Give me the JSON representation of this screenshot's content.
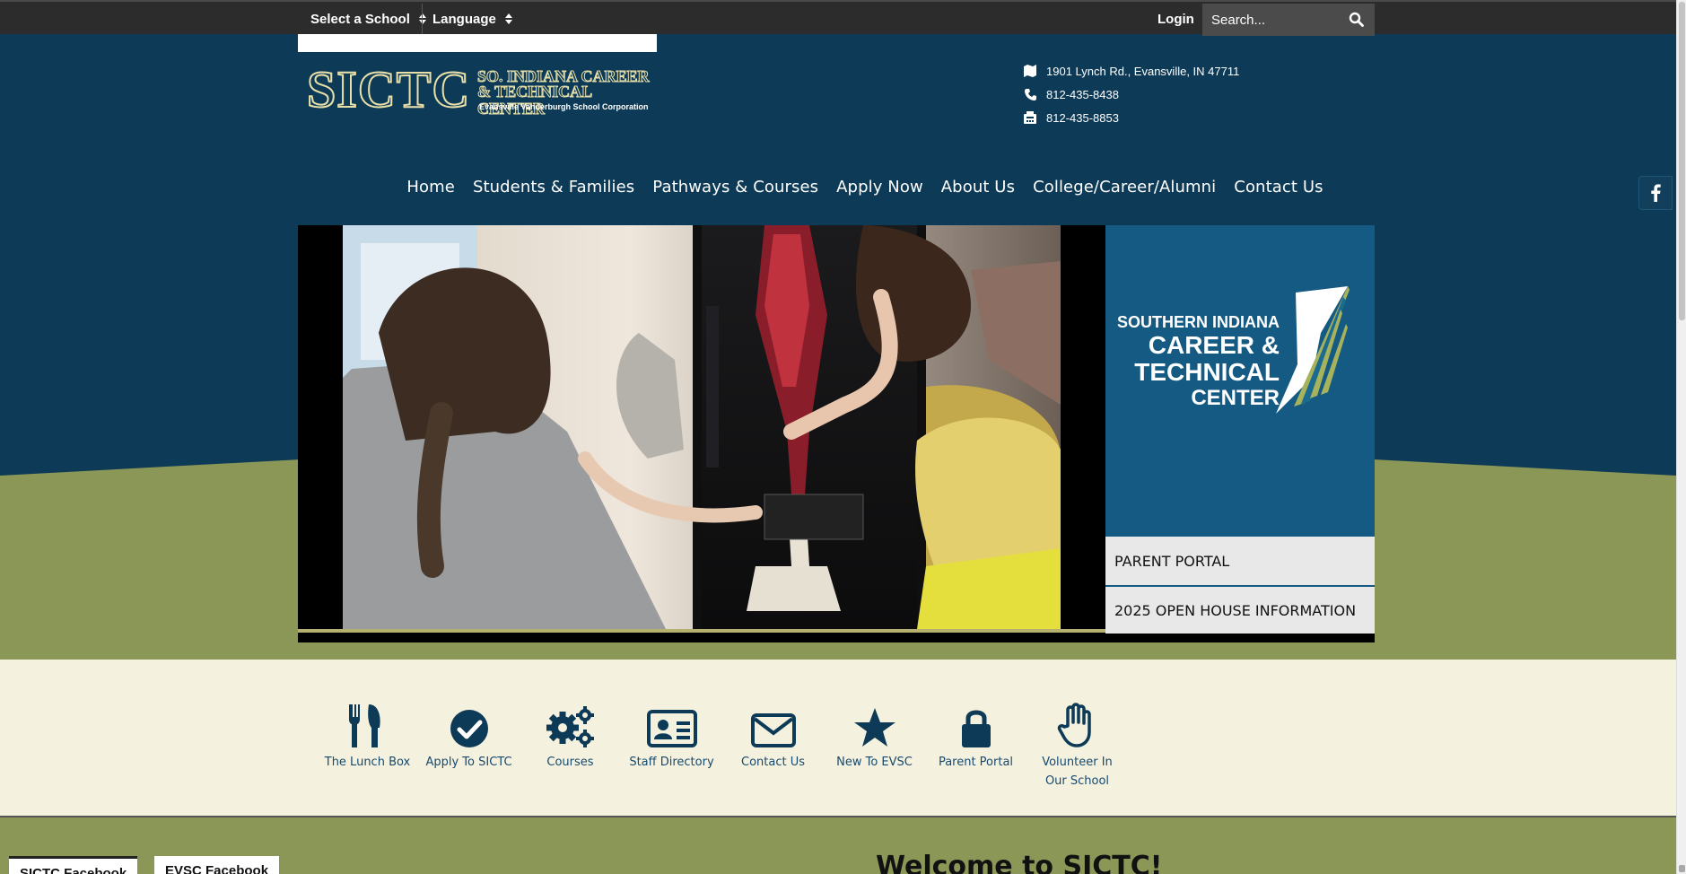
{
  "topbar": {
    "school_select": "Select a School",
    "language_select": "Language",
    "login": "Login",
    "search_placeholder": "Search..."
  },
  "header": {
    "logo_abbrev": "SICTC",
    "logo_name_line1": "SO. INDIANA CAREER",
    "logo_name_line2": "& TECHNICAL CENTER",
    "logo_subtitle": "Evansville Vanderburgh School Corporation",
    "address": "1901 Lynch Rd., Evansville, IN 47711",
    "phone": "812-435-8438",
    "fax": "812-435-8853"
  },
  "nav": {
    "items": [
      "Home",
      "Students & Families",
      "Pathways & Courses",
      "Apply Now",
      "About Us",
      "College/Career/Alumni",
      "Contact Us"
    ]
  },
  "promo": {
    "line1": "SOUTHERN INDIANA",
    "line2": "CAREER &",
    "line3": "TECHNICAL",
    "line4": "CENTER",
    "links": [
      "PARENT PORTAL",
      "2025 OPEN HOUSE INFORMATION"
    ]
  },
  "quick_links": [
    {
      "label": "The Lunch Box",
      "icon": "utensils-icon"
    },
    {
      "label": "Apply To SICTC",
      "icon": "check-circle-icon"
    },
    {
      "label": "Courses",
      "icon": "gears-icon"
    },
    {
      "label": "Staff Directory",
      "icon": "id-card-icon"
    },
    {
      "label": "Contact Us",
      "icon": "envelope-icon"
    },
    {
      "label": "New To EVSC",
      "icon": "star-icon"
    },
    {
      "label": "Parent Portal",
      "icon": "lock-icon"
    },
    {
      "label": "Volunteer In Our School",
      "icon": "hand-icon"
    }
  ],
  "bottom": {
    "tab1": "SICTC Facebook",
    "tab2": "EVSC Facebook",
    "welcome": "Welcome to SICTC!"
  },
  "colors": {
    "navy": "#0d3a56",
    "olive": "#8a9757",
    "cream": "#f5f1df",
    "promo_blue": "#155a82",
    "icon_blue": "#164a6e"
  }
}
